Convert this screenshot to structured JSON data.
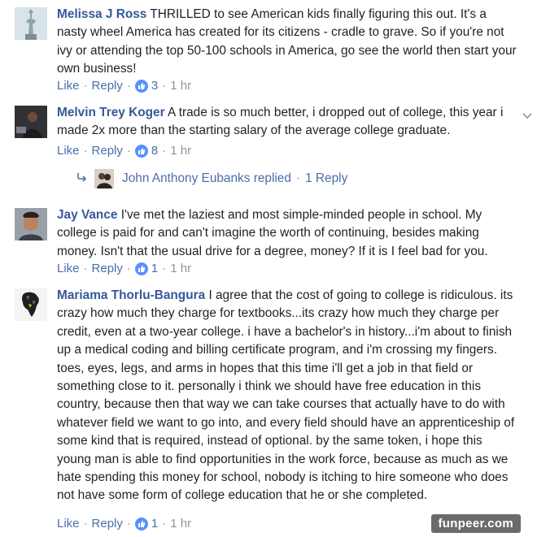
{
  "comments": [
    {
      "author": "Melissa J Ross",
      "text": "THRILLED to see American kids finally figuring this out. It's a nasty wheel America has created for its citizens - cradle to grave. So if you're not ivy or attending the top 50-100 schools in America, go see the world then start your own business!",
      "like": "Like",
      "reply": "Reply",
      "reactions": "3",
      "time": "1 hr"
    },
    {
      "author": "Melvin Trey Koger",
      "text": "A trade is so much better, i dropped out of college, this year i made 2x more than the starting salary of the average college graduate.",
      "like": "Like",
      "reply": "Reply",
      "reactions": "8",
      "time": "1 hr",
      "replies_summary": {
        "text": "John Anthony Eubanks replied",
        "count_link": "1 Reply"
      }
    },
    {
      "author": "Jay Vance",
      "text": "I've met the laziest and most simple-minded people in school. My college is paid for and can't imagine the worth of continuing, besides making money. Isn't that the usual drive for a degree, money? If it is I feel bad for you.",
      "like": "Like",
      "reply": "Reply",
      "reactions": "1",
      "time": "1 hr"
    },
    {
      "author": "Mariama Thorlu-Bangura",
      "text": "I agree that the cost of going to college is ridiculous. its crazy how much they charge for textbooks...its crazy how much they charge per credit, even at a two-year college. i have a bachelor's in history...i'm about to finish up a medical coding and billing certificate program, and i'm crossing my fingers. toes, eyes, legs, and arms in hopes that this time i'll get a job in that field or something close to it. personally i think we should have free education in this country, because then that way we can take courses that actually have to do with whatever field we want to go into, and every field should have an apprenticeship of some kind that is required, instead of optional. by the same token, i hope this young man is able to find opportunities in the work force, because as much as we hate spending this money for school, nobody is itching to hire someone who does not have some form of college education that he or she completed.",
      "like": "Like",
      "reply": "Reply",
      "reactions": "1",
      "time": "1 hr"
    }
  ],
  "separator": "·",
  "icons": {
    "reaction": "thumbs-up-icon",
    "reply_arrow": "reply-arrow-icon",
    "options": "chevron-down-icon"
  },
  "colors": {
    "author": "#365899",
    "link": "#4b6ea9",
    "meta": "#90949c",
    "like_blue": "#5890ff"
  },
  "watermark": "funpeer.com"
}
